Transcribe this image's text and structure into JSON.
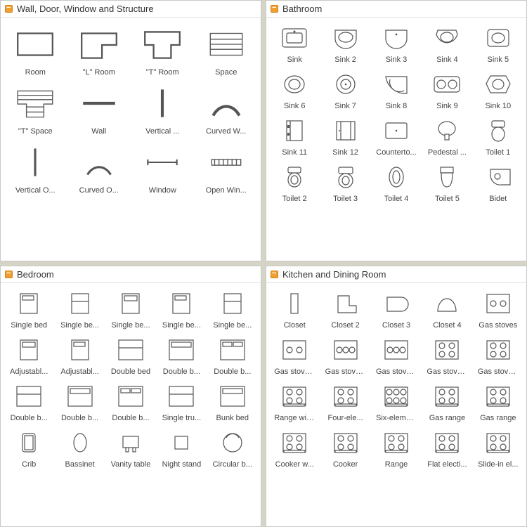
{
  "panels": [
    {
      "id": "wall",
      "title": "Wall, Door, Window and Structure",
      "cols": 4,
      "items": [
        {
          "label": "Room",
          "icon": "room"
        },
        {
          "label": "\"L\" Room",
          "icon": "l-room"
        },
        {
          "label": "\"T\" Room",
          "icon": "t-room"
        },
        {
          "label": "Space",
          "icon": "space"
        },
        {
          "label": "\"T\" Space",
          "icon": "t-space"
        },
        {
          "label": "Wall",
          "icon": "wall"
        },
        {
          "label": "Vertical ...",
          "icon": "vertical-wall"
        },
        {
          "label": "Curved W...",
          "icon": "curved-wall"
        },
        {
          "label": "Vertical O...",
          "icon": "vertical-open"
        },
        {
          "label": "Curved O...",
          "icon": "curved-open"
        },
        {
          "label": "Window",
          "icon": "window"
        },
        {
          "label": "Open Win...",
          "icon": "open-window"
        }
      ]
    },
    {
      "id": "bathroom",
      "title": "Bathroom",
      "cols": 5,
      "items": [
        {
          "label": "Sink",
          "icon": "sink1"
        },
        {
          "label": "Sink 2",
          "icon": "sink2"
        },
        {
          "label": "Sink 3",
          "icon": "sink3"
        },
        {
          "label": "Sink 4",
          "icon": "sink4"
        },
        {
          "label": "Sink 5",
          "icon": "sink5"
        },
        {
          "label": "Sink 6",
          "icon": "sink6"
        },
        {
          "label": "Sink 7",
          "icon": "sink7"
        },
        {
          "label": "Sink 8",
          "icon": "sink8"
        },
        {
          "label": "Sink 9",
          "icon": "sink9"
        },
        {
          "label": "Sink 10",
          "icon": "sink10"
        },
        {
          "label": "Sink 11",
          "icon": "sink11"
        },
        {
          "label": "Sink 12",
          "icon": "sink12"
        },
        {
          "label": "Counterto...",
          "icon": "countertop"
        },
        {
          "label": "Pedestal ...",
          "icon": "pedestal"
        },
        {
          "label": "Toilet 1",
          "icon": "toilet1"
        },
        {
          "label": "Toilet 2",
          "icon": "toilet2"
        },
        {
          "label": "Toilet 3",
          "icon": "toilet3"
        },
        {
          "label": "Toilet 4",
          "icon": "toilet4"
        },
        {
          "label": "Toilet 5",
          "icon": "toilet5"
        },
        {
          "label": "Bidet",
          "icon": "bidet"
        }
      ]
    },
    {
      "id": "bedroom",
      "title": "Bedroom",
      "cols": 5,
      "items": [
        {
          "label": "Single bed",
          "icon": "bed1"
        },
        {
          "label": "Single be...",
          "icon": "bed2"
        },
        {
          "label": "Single be...",
          "icon": "bed3"
        },
        {
          "label": "Single be...",
          "icon": "bed4"
        },
        {
          "label": "Single be...",
          "icon": "bed5"
        },
        {
          "label": "Adjustabl...",
          "icon": "bed6"
        },
        {
          "label": "Adjustabl...",
          "icon": "bed7"
        },
        {
          "label": "Double bed",
          "icon": "bed8"
        },
        {
          "label": "Double b...",
          "icon": "bed9"
        },
        {
          "label": "Double b...",
          "icon": "bed10"
        },
        {
          "label": "Double b...",
          "icon": "bed11"
        },
        {
          "label": "Double b...",
          "icon": "bed12"
        },
        {
          "label": "Double b...",
          "icon": "bed13"
        },
        {
          "label": "Single tru...",
          "icon": "bed14"
        },
        {
          "label": "Bunk bed",
          "icon": "bed15"
        },
        {
          "label": "Crib",
          "icon": "crib"
        },
        {
          "label": "Bassinet",
          "icon": "bassinet"
        },
        {
          "label": "Vanity table",
          "icon": "vanity"
        },
        {
          "label": "Night stand",
          "icon": "nightstand"
        },
        {
          "label": "Circular b...",
          "icon": "circularbed"
        }
      ]
    },
    {
      "id": "kitchen",
      "title": "Kitchen and Dining Room",
      "cols": 5,
      "items": [
        {
          "label": "Closet",
          "icon": "closet1"
        },
        {
          "label": "Closet 2",
          "icon": "closet2"
        },
        {
          "label": "Closet 3",
          "icon": "closet3"
        },
        {
          "label": "Closet 4",
          "icon": "closet4"
        },
        {
          "label": "Gas stoves",
          "icon": "stove1"
        },
        {
          "label": "Gas stove...",
          "icon": "stove2"
        },
        {
          "label": "Gas stove...",
          "icon": "stove3"
        },
        {
          "label": "Gas stove...",
          "icon": "stove4"
        },
        {
          "label": "Gas stove...",
          "icon": "stove5"
        },
        {
          "label": "Gas stove...",
          "icon": "stove6"
        },
        {
          "label": "Range wit...",
          "icon": "range1"
        },
        {
          "label": "Four-ele...",
          "icon": "range2"
        },
        {
          "label": "Six-eleme...",
          "icon": "range3"
        },
        {
          "label": "Gas range",
          "icon": "range4"
        },
        {
          "label": "Gas range",
          "icon": "range5"
        },
        {
          "label": "Cooker w...",
          "icon": "cooker1"
        },
        {
          "label": "Cooker",
          "icon": "cooker2"
        },
        {
          "label": "Range",
          "icon": "cooker3"
        },
        {
          "label": "Flat electi...",
          "icon": "cooker4"
        },
        {
          "label": "Slide-in el...",
          "icon": "cooker5"
        }
      ]
    }
  ]
}
